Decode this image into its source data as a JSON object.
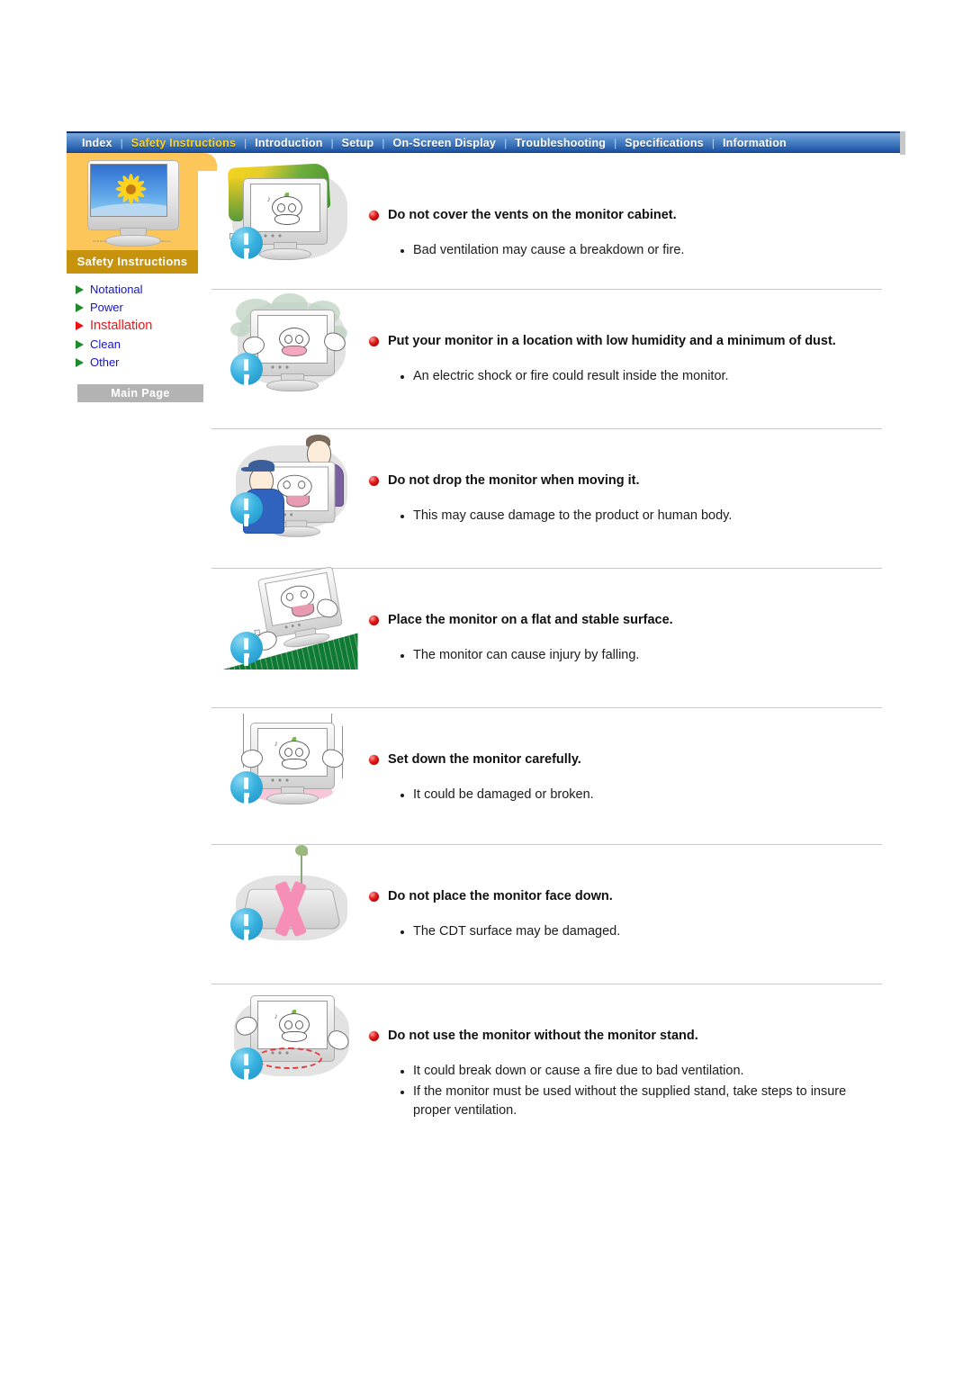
{
  "nav": {
    "items": [
      {
        "label": "Index",
        "active": false
      },
      {
        "label": "Safety Instructions",
        "active": true
      },
      {
        "label": "Introduction",
        "active": false
      },
      {
        "label": "Setup",
        "active": false
      },
      {
        "label": "On-Screen Display",
        "active": false
      },
      {
        "label": "Troubleshooting",
        "active": false
      },
      {
        "label": "Specifications",
        "active": false
      },
      {
        "label": "Information",
        "active": false
      }
    ],
    "separator": "|"
  },
  "sidebar": {
    "title": "Safety Instructions",
    "thumbnail_icon": "monitor-sunflower-image",
    "links": [
      {
        "label": "Notational",
        "active": false
      },
      {
        "label": "Power",
        "active": false
      },
      {
        "label": "Installation",
        "active": true
      },
      {
        "label": "Clean",
        "active": false
      },
      {
        "label": "Other",
        "active": false
      }
    ],
    "main_page_button": "Main Page"
  },
  "colors": {
    "nav_active": "#ffd21e",
    "nav_bg_top": "#7ba7dd",
    "nav_bg_bottom": "#16438a",
    "sidebar_orange": "#fcc65a",
    "sidebar_title_bg": "#c8930c",
    "link_blue": "#1313cf",
    "link_active_red": "#ef1414",
    "arrow_green": "#1f8a2a",
    "bullet_red_sphere": "#e01515",
    "main_page_gray": "#b3b3b3"
  },
  "sections": [
    {
      "illustration": "monitor-covered-with-cloth",
      "heading": "Do not cover the vents on the monitor cabinet.",
      "bullets": [
        "Bad ventilation may cause a breakdown or fire."
      ]
    },
    {
      "illustration": "monitor-in-dusty-humid-place",
      "heading": "Put your monitor in a location with low humidity and a minimum of dust.",
      "bullets": [
        "An electric shock or fire could result inside the monitor."
      ]
    },
    {
      "illustration": "two-people-carrying-monitor",
      "heading": "Do not drop the monitor when moving it.",
      "bullets": [
        "This may cause damage to the product or human body."
      ]
    },
    {
      "illustration": "monitor-sliding-on-slope",
      "heading": "Place the monitor on a flat and stable surface.",
      "bullets": [
        "The monitor can cause injury by falling."
      ]
    },
    {
      "illustration": "monitor-dropped-hard",
      "heading": "Set down the monitor carefully.",
      "bullets": [
        "It could be damaged or broken."
      ]
    },
    {
      "illustration": "monitor-face-down-crossed-out",
      "heading": "Do not place the monitor face down.",
      "bullets": [
        "The CDT surface may be damaged."
      ]
    },
    {
      "illustration": "monitor-without-stand",
      "heading": "Do not use the monitor without the monitor stand.",
      "bullets": [
        "It could break down or cause a fire due to bad ventilation.",
        "If the monitor must be used without the supplied stand, take steps to insure proper ventilation."
      ]
    }
  ]
}
